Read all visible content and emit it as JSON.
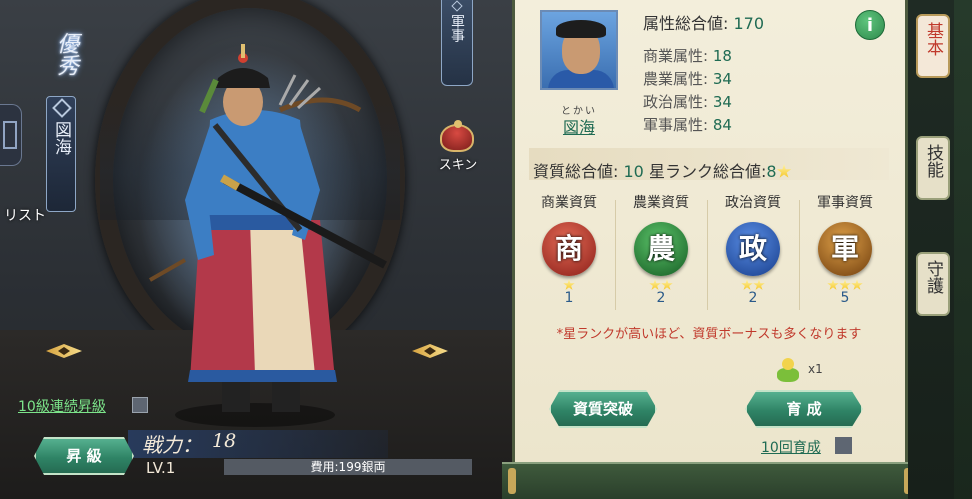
{
  "left": {
    "rank_mark": "優秀",
    "name": "図海",
    "list_label": "リスト",
    "military_tag": "軍事",
    "skin_label": "スキン",
    "continuous_label": "10級連続昇級",
    "upgrade_button": "昇 級",
    "power_label": "戦力：",
    "power_value": "18",
    "level": "LV.1",
    "cost": "費用:199銀両"
  },
  "panel": {
    "ruby": "とかい",
    "name": "図海",
    "attr_total_label": "属性総合値:",
    "attr_total_value": "170",
    "attributes": [
      {
        "label": "商業属性:",
        "value": "18"
      },
      {
        "label": "農業属性:",
        "value": "34"
      },
      {
        "label": "政治属性:",
        "value": "34"
      },
      {
        "label": "軍事属性:",
        "value": "84"
      }
    ],
    "quality_total_label": "資質総合値:",
    "quality_total_value": "10",
    "star_total_label": "星ランク総合値:",
    "star_total_value": "8",
    "qualities": [
      {
        "label": "商業資質",
        "glyph": "商",
        "stars": 1,
        "value": "1",
        "color": "#b8302a"
      },
      {
        "label": "農業資質",
        "glyph": "農",
        "stars": 2,
        "value": "2",
        "color": "#2f8c3b"
      },
      {
        "label": "政治資質",
        "glyph": "政",
        "stars": 2,
        "value": "2",
        "color": "#2a5fb8"
      },
      {
        "label": "軍事資質",
        "glyph": "軍",
        "stars": 3,
        "value": "5",
        "color": "#a8681c"
      }
    ],
    "note": "*星ランクが高いほど、資質ボーナスも多くなります",
    "breakthrough_button": "資質突破",
    "train_button": "育 成",
    "train_cost": "x1",
    "train_ten_label": "10回育成"
  },
  "tabs": [
    {
      "label": "基本",
      "active": true
    },
    {
      "label": "技能",
      "active": false
    },
    {
      "label": "守護",
      "active": false
    }
  ],
  "icons": {
    "info": "info-icon",
    "star": "star-icon",
    "skin": "skin-hat-icon",
    "pill": "growth-pill-icon"
  }
}
